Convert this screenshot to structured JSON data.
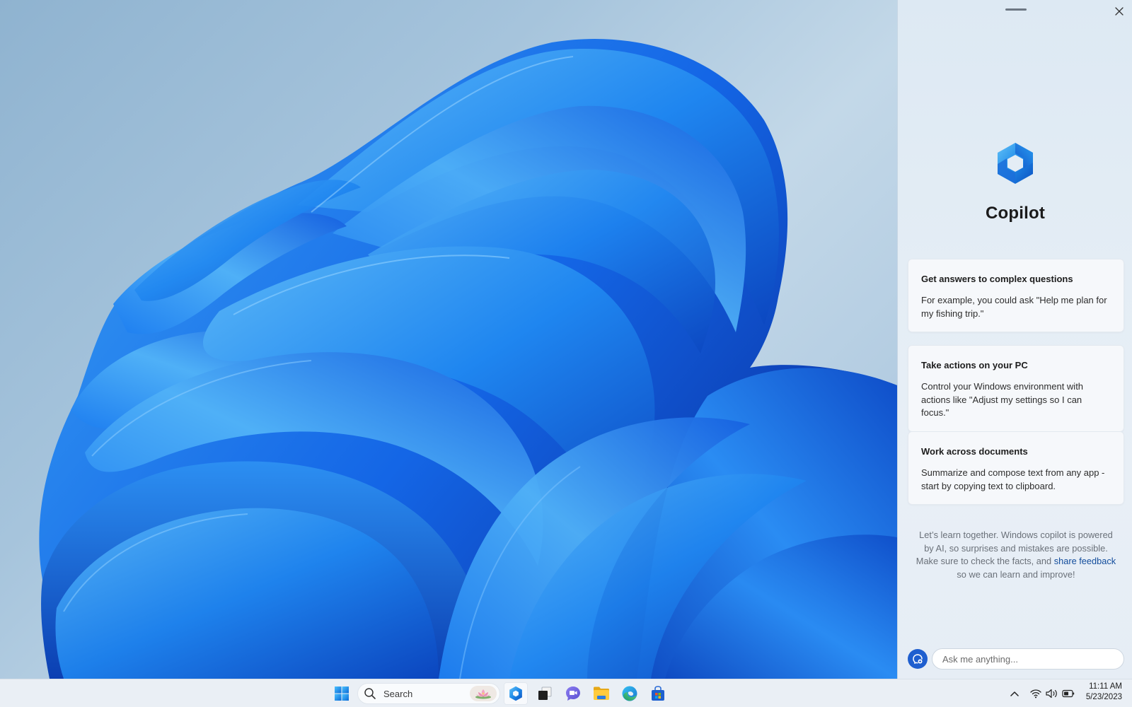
{
  "desktop": {
    "wallpaper": "windows-11-bloom-blue",
    "colors": {
      "bloom_light": "#4fb0f5",
      "bloom_mid": "#1a7ff0",
      "bloom_dark": "#0a3fb8",
      "sky": "#a9c5dc"
    }
  },
  "copilot": {
    "title": "Copilot",
    "drag_handle": "drag-handle",
    "close_icon": "close-icon",
    "logo_icon": "copilot-logo-icon",
    "cards": [
      {
        "title": "Get answers to complex questions",
        "body": "For example, you could ask \"Help me plan for my fishing trip.\""
      },
      {
        "title": "Take actions on your PC",
        "body": "Control your Windows environment with actions like \"Adjust my settings so I can focus.\""
      },
      {
        "title": "Work across documents",
        "body": "Summarize and compose text from any app - start by copying text to clipboard."
      }
    ],
    "disclaimer": {
      "text_before": "Let’s learn together. Windows copilot is powered by AI, so surprises and mistakes are possible. Make sure to check the facts, and ",
      "link_text": "share feedback",
      "text_after": " so we can learn and improve!",
      "link_color": "#124c9c"
    },
    "input": {
      "placeholder": "Ask me anything...",
      "value": ""
    },
    "new_topic_icon": "new-topic-icon",
    "accent": "#1f5fcf"
  },
  "taskbar": {
    "start_icon": "windows-start-icon",
    "search": {
      "label": "Search",
      "icon": "search-icon",
      "highlight_icon": "lotus-icon"
    },
    "apps": [
      {
        "name": "Copilot",
        "icon": "copilot-icon",
        "active": true
      },
      {
        "name": "Task View",
        "icon": "task-view-icon",
        "active": false
      },
      {
        "name": "Teams Chat",
        "icon": "chat-icon",
        "active": false
      },
      {
        "name": "File Explorer",
        "icon": "folder-icon",
        "active": false
      },
      {
        "name": "Microsoft Edge",
        "icon": "edge-icon",
        "active": false
      },
      {
        "name": "Microsoft Store",
        "icon": "store-icon",
        "active": false
      }
    ],
    "tray": {
      "overflow_icon": "chevron-up-icon",
      "wifi_icon": "wifi-icon",
      "volume_icon": "volume-icon",
      "battery_icon": "battery-icon"
    },
    "clock": {
      "time": "11:11 AM",
      "date": "5/23/2023"
    }
  }
}
